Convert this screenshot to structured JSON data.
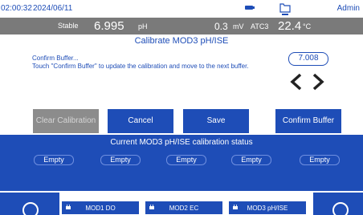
{
  "status": {
    "time": "02:00:32",
    "date": "2024/06/11",
    "user": "Admin",
    "icons": [
      "battery-icon",
      "folder-icon"
    ]
  },
  "reading": {
    "stability": "Stable",
    "ph_value": "6.995",
    "ph_unit": "pH",
    "mv_value": "0.3",
    "mv_unit": "mV",
    "atc": "ATC3",
    "temp_value": "22.4",
    "temp_unit": "°C"
  },
  "dialog": {
    "title": "Calibrate MOD3 pH/ISE",
    "line1": "Confirm Buffer...",
    "line2": "Touch \"Confirm Buffer\" to update the calibration and move to the next buffer.",
    "standard_value": "7.008"
  },
  "buttons": {
    "clear": "Clear Calibration",
    "cancel": "Cancel",
    "save": "Save",
    "confirm": "Confirm Buffer"
  },
  "calibration_status": {
    "title": "Current MOD3 pH/ISE calibration status",
    "slots": [
      "Empty",
      "Empty",
      "Empty",
      "Empty",
      "Empty"
    ]
  },
  "tabs": [
    "MOD1 DO",
    "MOD2 EC",
    "MOD3 pH/ISE"
  ],
  "colors": {
    "accent": "#1e4db7",
    "reading_bar": "#7a7a7a",
    "disabled": "#8c8c8c"
  }
}
